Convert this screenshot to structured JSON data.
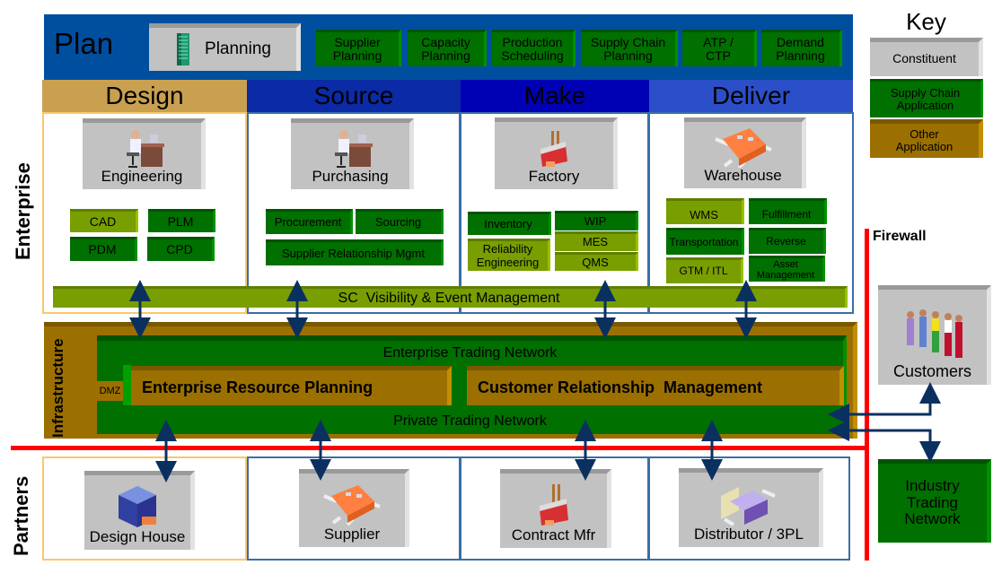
{
  "plan": {
    "title": "Plan",
    "constituent": "Planning",
    "apps": [
      "Supplier Planning",
      "Capacity Planning",
      "Production Scheduling",
      "Supply Chain Planning",
      "ATP / CTP",
      "Demand Planning"
    ]
  },
  "phases": [
    "Design",
    "Source",
    "Make",
    "Deliver"
  ],
  "enterprise_label": "Enterprise",
  "infrastructure_label": "Infrastructure",
  "partners_label": "Partners",
  "constituents": {
    "engineering": "Engineering",
    "purchasing": "Purchasing",
    "factory": "Factory",
    "warehouse": "Warehouse"
  },
  "design_apps": {
    "cad": "CAD",
    "plm": "PLM",
    "pdm": "PDM",
    "cpd": "CPD"
  },
  "source_apps": {
    "procurement": "Procurement",
    "sourcing": "Sourcing",
    "srm": "Supplier Relationship Mgmt"
  },
  "make_apps": {
    "inventory": "Inventory",
    "reliability": "Reliability Engineering",
    "wip": "WIP",
    "mes": "MES",
    "qms": "QMS"
  },
  "deliver_apps": {
    "wms": "WMS",
    "fulfillment": "Fulfillment",
    "transportation": "Transportation",
    "reverse": "Reverse",
    "gtm": "GTM / ITL",
    "asset": "Asset Management"
  },
  "sc_visibility": "SC  Visibility & Event Management",
  "infrastructure": {
    "etn": "Enterprise Trading Network",
    "dmz": "DMZ",
    "erp": "Enterprise Resource Planning",
    "crm": "Customer Relationship  Management",
    "ptn": "Private Trading Network"
  },
  "partners": {
    "design_house": "Design House",
    "supplier": "Supplier",
    "contract_mfr": "Contract Mfr",
    "distributor": "Distributor / 3PL"
  },
  "external": {
    "customers": "Customers",
    "itn": "Industry Trading Network"
  },
  "firewall": "Firewall",
  "key": {
    "title": "Key",
    "constituent": "Constituent",
    "sca": "Supply Chain Application",
    "other": "Other Application"
  },
  "colors": {
    "plan": "#004f9f",
    "design": "#c8a050",
    "source": "#0a2aa6",
    "make": "#0000b4",
    "deliver": "#2a4fc8",
    "sc_app": "#007000",
    "sc_app_alt": "#799e00",
    "other_app": "#9c7000",
    "constituent": "#c2c2c2",
    "firewall": "#ff0000",
    "arrow": "#0a3060"
  }
}
